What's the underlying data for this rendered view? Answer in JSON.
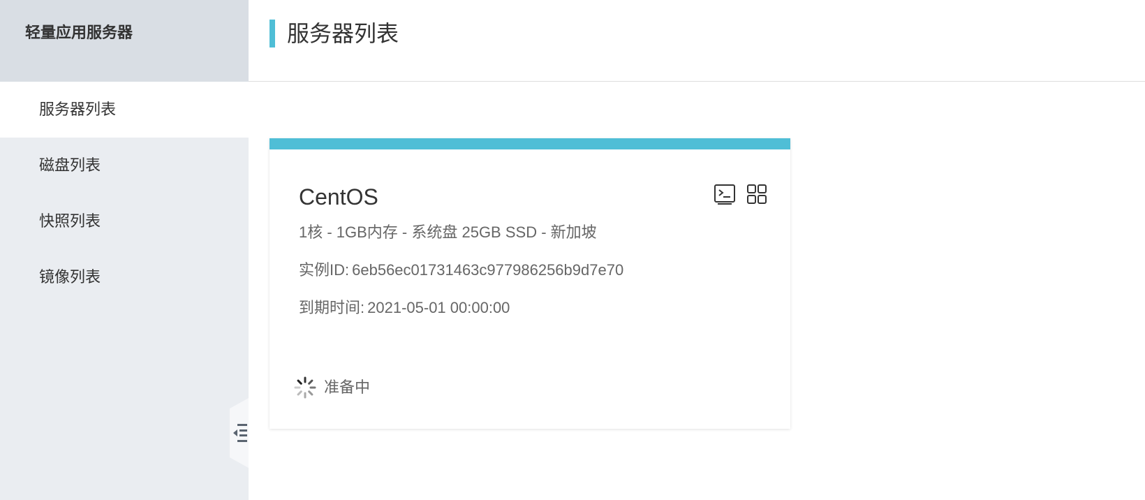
{
  "sidebar": {
    "title": "轻量应用服务器",
    "items": [
      {
        "label": "服务器列表"
      },
      {
        "label": "磁盘列表"
      },
      {
        "label": "快照列表"
      },
      {
        "label": "镜像列表"
      }
    ]
  },
  "header": {
    "title": "服务器列表"
  },
  "card": {
    "os": "CentOS",
    "spec": "1核 - 1GB内存 - 系统盘 25GB SSD - 新加坡",
    "instance_label": "实例ID:",
    "instance_id": "6eb56ec01731463c977986256b9d7e70",
    "expire_label": "到期时间:",
    "expire_value": "2021-05-01 00:00:00",
    "status": "准备中",
    "icons": [
      "terminal-icon",
      "grid-icon"
    ]
  },
  "colors": {
    "accent": "#4fbed6",
    "sidebar_bg": "#eaedf1",
    "sidebar_header_bg": "#d9dee4"
  }
}
